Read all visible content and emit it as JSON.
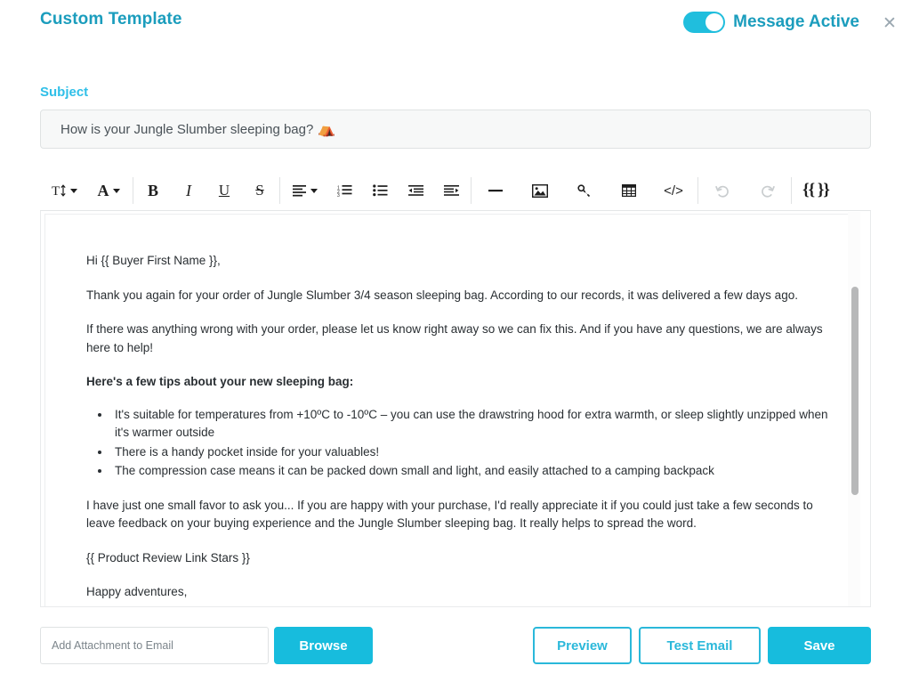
{
  "header": {
    "title": "Custom Template",
    "toggle_label": "Message Active",
    "toggle_state": "on",
    "close_icon": "close-icon",
    "accent_dark": "#1b9dbd",
    "accent_bright": "#2fbfe8",
    "toggle_color": "#20bedd"
  },
  "subject": {
    "label": "Subject",
    "value": "How is your Jungle Slumber sleeping bag?",
    "emoji": "⛺",
    "emoji_name": "tent-emoji",
    "placeholder": "Subject"
  },
  "toolbar": {
    "groups": [
      {
        "items": [
          {
            "name": "text-size-icon",
            "label": "T",
            "has_caret": true,
            "disabled": false
          },
          {
            "name": "font-color-icon",
            "label": "A",
            "has_caret": true,
            "disabled": false
          }
        ]
      },
      {
        "items": [
          {
            "name": "bold-icon",
            "label": "B",
            "has_caret": false,
            "disabled": false
          },
          {
            "name": "italic-icon",
            "label": "I",
            "has_caret": false,
            "disabled": false
          },
          {
            "name": "underline-icon",
            "label": "U",
            "has_caret": false,
            "disabled": false
          },
          {
            "name": "strikethrough-icon",
            "label": "S",
            "has_caret": false,
            "disabled": false
          }
        ]
      },
      {
        "items": [
          {
            "name": "align-icon",
            "label": "",
            "has_caret": true,
            "disabled": false
          },
          {
            "name": "ordered-list-icon",
            "label": "",
            "has_caret": false,
            "disabled": false
          },
          {
            "name": "unordered-list-icon",
            "label": "",
            "has_caret": false,
            "disabled": false
          },
          {
            "name": "outdent-icon",
            "label": "",
            "has_caret": false,
            "disabled": false
          },
          {
            "name": "indent-icon",
            "label": "",
            "has_caret": false,
            "disabled": false
          }
        ]
      },
      {
        "items": [
          {
            "name": "horizontal-rule-icon",
            "label": "",
            "has_caret": false,
            "disabled": false
          },
          {
            "name": "image-icon",
            "label": "",
            "has_caret": false,
            "disabled": false
          },
          {
            "name": "link-icon",
            "label": "",
            "has_caret": false,
            "disabled": false
          },
          {
            "name": "table-icon",
            "label": "",
            "has_caret": false,
            "disabled": false
          },
          {
            "name": "code-icon",
            "label": "</>",
            "has_caret": false,
            "disabled": false
          }
        ]
      },
      {
        "items": [
          {
            "name": "undo-icon",
            "label": "",
            "has_caret": false,
            "disabled": true
          },
          {
            "name": "redo-icon",
            "label": "",
            "has_caret": false,
            "disabled": true
          }
        ]
      },
      {
        "items": [
          {
            "name": "merge-tag-icon",
            "label": "{{ }}",
            "has_caret": false,
            "disabled": false
          }
        ]
      }
    ]
  },
  "editor": {
    "greeting": "Hi {{ Buyer First Name }},",
    "paragraph_1": "Thank you again for your order of Jungle Slumber 3/4 season sleeping bag. According to our records, it was delivered a few days ago.",
    "paragraph_2": "If there was anything wrong with your order, please let us know right away so we can fix this. And if you have any questions, we are always here to help!",
    "tips_heading": "Here's a few tips about your new sleeping bag:",
    "tips": [
      "It's suitable for temperatures from +10ºC to -10ºC – you can use the drawstring hood for extra warmth, or sleep slightly unzipped when it's warmer outside",
      "There is a handy pocket inside for your valuables!",
      "The compression case means it can be packed down small and light, and easily attached to a camping backpack"
    ],
    "paragraph_3": "I have just one small favor to ask you... If you are happy with your purchase, I'd really appreciate it if you could just take a few seconds to leave feedback on your buying experience and the Jungle Slumber sleeping bag. It really helps to spread the word.",
    "review_tag": "{{ Product Review Link Stars }}",
    "signoff": "Happy adventures,"
  },
  "footer": {
    "attachment_placeholder": "Add Attachment to Email",
    "attachment_value": "",
    "browse_label": "Browse",
    "preview_label": "Preview",
    "test_email_label": "Test Email",
    "save_label": "Save",
    "solid_color": "#17bcdd",
    "outline_color": "#2ab8da"
  }
}
